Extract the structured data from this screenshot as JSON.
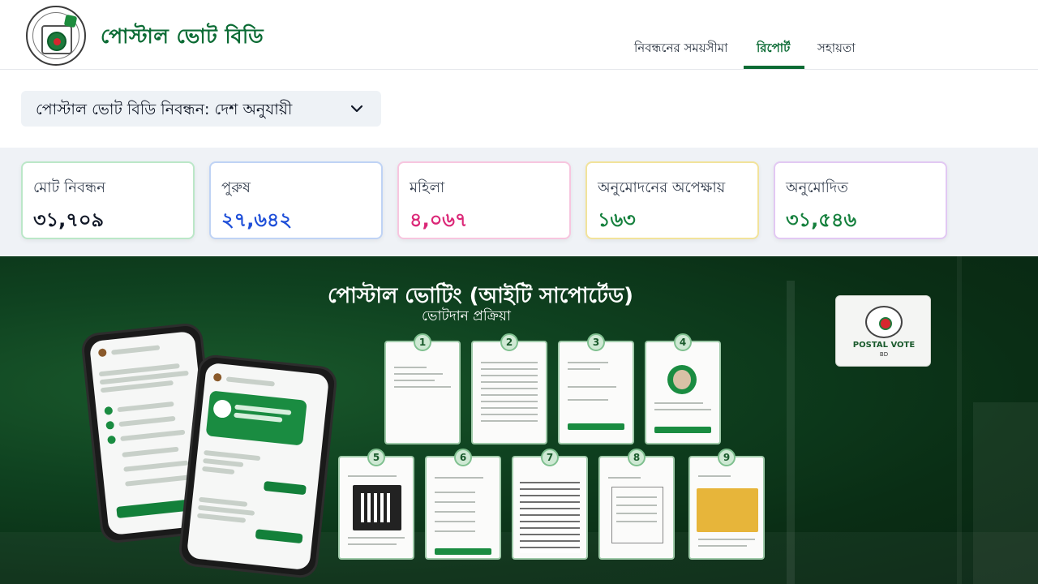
{
  "brand": {
    "title": "পোস্টাল ভোট বিডি"
  },
  "nav": {
    "items": [
      {
        "label": "নিবন্ধনের সময়সীমা"
      },
      {
        "label": "রিপোর্ট"
      },
      {
        "label": "সহায়তা"
      }
    ],
    "active_index": 1
  },
  "report_selector": {
    "value": "পোস্টাল ভোট বিডি নিবন্ধন: দেশ অনুযায়ী"
  },
  "stats": [
    {
      "title": "মোট নিবন্ধন",
      "value": "৩১,৭০৯",
      "color": "#111827",
      "border": "#bbe7c8"
    },
    {
      "title": "পুরুষ",
      "value": "২৭,৬৪২",
      "color": "#1d4ed8",
      "border": "#bfd3f5"
    },
    {
      "title": "মহিলা",
      "value": "৪,০৬৭",
      "color": "#db2777",
      "border": "#f7c6df"
    },
    {
      "title": "অনুমোদনের অপেক্ষায়",
      "value": "১৬৩",
      "color": "#15803d",
      "border": "#f2e39b"
    },
    {
      "title": "অনুমোদিত",
      "value": "৩১,৫৪৬",
      "color": "#15803d",
      "border": "#e2c8f3"
    }
  ],
  "banner": {
    "title": "পোস্টাল ভোটিং (আইটি সাপোর্টেড)",
    "subtitle": "ভোটদান প্রক্রিয়া",
    "logo_text": "POSTAL VOTE",
    "logo_subtext": "BD",
    "steps": [
      "1",
      "2",
      "3",
      "4",
      "5",
      "6",
      "7",
      "8",
      "9"
    ]
  }
}
